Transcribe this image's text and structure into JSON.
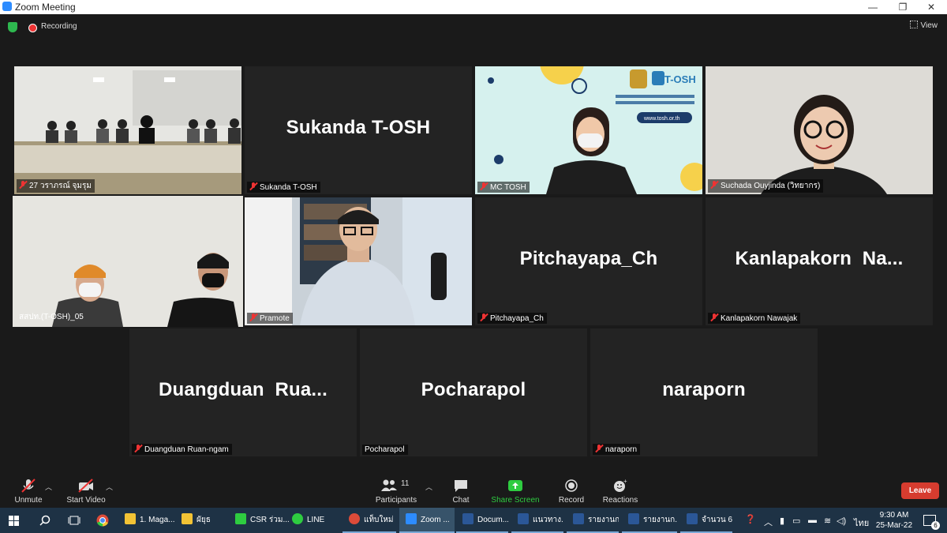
{
  "window": {
    "title": "Zoom Meeting",
    "controls": [
      "—",
      "❐",
      "✕"
    ]
  },
  "meeting": {
    "recording_label": "Recording",
    "view_label": "View"
  },
  "tiles": [
    {
      "display": "",
      "name": "27 วราภรณ์ จุมรุม"
    },
    {
      "display": "Sukanda T-OSH",
      "name": "Sukanda T-OSH"
    },
    {
      "display": "",
      "name": "MC TOSH",
      "banner": {
        "brand": "T-OSH",
        "url": "www.tosh.or.th"
      }
    },
    {
      "display": "",
      "name": "Suchada Ouyjinda (วิทยากร)"
    },
    {
      "display": "",
      "name": "สสปท.(T-OSH)_05"
    },
    {
      "display": "",
      "name": "Pramote"
    },
    {
      "display": "Pitchayapa_Ch",
      "name": "Pitchayapa_Ch"
    },
    {
      "display": "Kanlapakorn  Na...",
      "name": "Kanlapakorn Nawajak"
    },
    {
      "display": "Duangduan  Rua...",
      "name": "Duangduan Ruan-ngam"
    },
    {
      "display": "Pocharapol",
      "name": "Pocharapol"
    },
    {
      "display": "naraporn",
      "name": "naraporn"
    }
  ],
  "controls": {
    "unmute": "Unmute",
    "start_video": "Start Video",
    "participants": "Participants",
    "participants_count": "11",
    "chat": "Chat",
    "share_screen": "Share Screen",
    "record": "Record",
    "reactions": "Reactions",
    "leave": "Leave"
  },
  "taskbar": {
    "apps": [
      {
        "label": "1. Maga...",
        "color": "#f2c335"
      },
      {
        "label": "ผัยุธ",
        "color": "#f2c335"
      },
      {
        "label": "CSR ร่วม...",
        "color": "#2ecc40"
      },
      {
        "label": "LINE",
        "color": "#2ecc40"
      },
      {
        "label": "แท็บใหม่ ...",
        "color": "#dd4b39"
      },
      {
        "label": "Zoom ...",
        "color": "#2d8cff"
      },
      {
        "label": "Docum...",
        "color": "#2b5797"
      },
      {
        "label": "แนวทาง...",
        "color": "#2b5797"
      },
      {
        "label": "รายงานก...",
        "color": "#2b5797"
      },
      {
        "label": "รายงานก...",
        "color": "#2b5797"
      },
      {
        "label": "จำนวน 6...",
        "color": "#2b5797"
      }
    ],
    "lang": "ไทย",
    "time": "9:30 AM",
    "date": "25-Mar-22",
    "notifications": "6"
  }
}
